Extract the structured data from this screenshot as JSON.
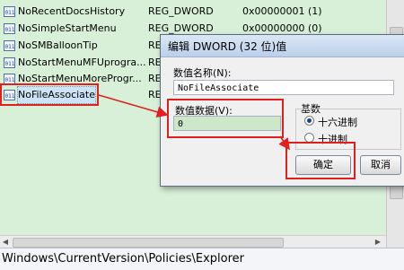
{
  "registry_rows": [
    {
      "name": "NoRecentDocsHistory",
      "type": "REG_DWORD",
      "value": "0x00000001 (1)"
    },
    {
      "name": "NoSimpleStartMenu",
      "type": "REG_DWORD",
      "value": "0x00000000 (0)"
    },
    {
      "name": "NoSMBalloonTip",
      "type": "REG",
      "value": ""
    },
    {
      "name": "NoStartMenuMFUprogra...",
      "type": "REC",
      "value": ""
    },
    {
      "name": "NoStartMenuMoreProgr...",
      "type": "REC",
      "value": ""
    },
    {
      "name": "NoFileAssociate",
      "type": "REC",
      "value": ""
    }
  ],
  "status_path": "Windows\\CurrentVersion\\Policies\\Explorer",
  "dialog": {
    "title": "编辑 DWORD (32 位)值",
    "value_name_label": "数值名称(N):",
    "value_name": "NoFileAssociate",
    "value_data_label": "数值数据(V):",
    "value_data": "0",
    "base_label": "基数",
    "hex_label": "十六进制",
    "dec_label": "十进制",
    "selected_base": "hex",
    "ok_label": "确定",
    "cancel_label": "取消"
  },
  "colors": {
    "highlight_red": "#e02020",
    "list_background": "#d8f0d8"
  }
}
